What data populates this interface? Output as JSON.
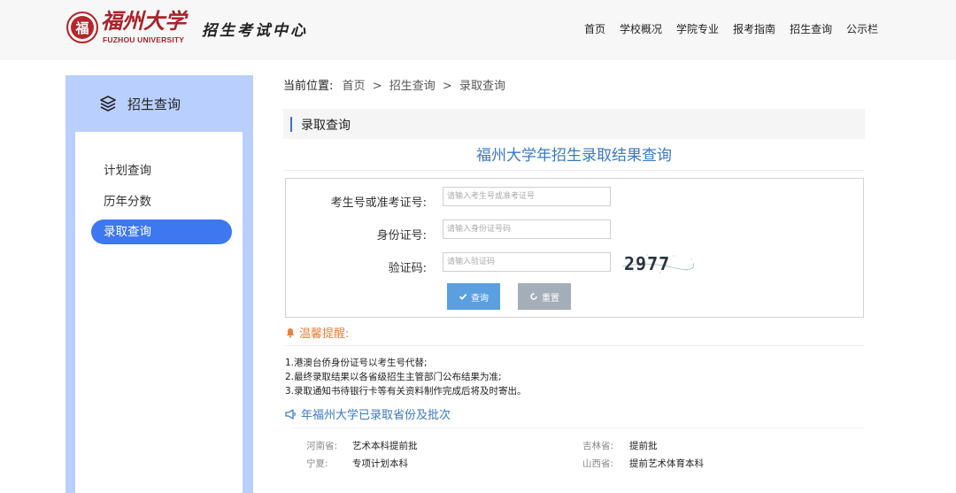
{
  "header": {
    "logo_seal_char": "福",
    "logo_cn": "福州大学",
    "logo_en": "FUZHOU UNIVERSITY",
    "site_name": "招生考试中心",
    "nav": [
      "首页",
      "学校概况",
      "学院专业",
      "报考指南",
      "招生查询",
      "公示栏"
    ]
  },
  "sidebar": {
    "title": "招生查询",
    "title_icon": "layers-icon",
    "items": [
      {
        "label": "计划查询",
        "active": false
      },
      {
        "label": "历年分数",
        "active": false
      },
      {
        "label": "录取查询",
        "active": true
      }
    ],
    "accent_color": "#b9d0ff",
    "active_color": "#3d78f0"
  },
  "breadcrumb": {
    "label": "当前位置:",
    "items": [
      "首页",
      "招生查询",
      "录取查询"
    ],
    "separator": ">"
  },
  "section": {
    "title": "录取查询",
    "heading": "福州大学年招生录取结果查询"
  },
  "form": {
    "fields": [
      {
        "label": "考生号或准考证号:",
        "placeholder": "请输入考生号或准考证号",
        "value": ""
      },
      {
        "label": "身份证号:",
        "placeholder": "请输入身份证号码",
        "value": ""
      },
      {
        "label": "验证码:",
        "placeholder": "请输入验证码",
        "value": ""
      }
    ],
    "captcha_text": "2977",
    "query_button": "查询",
    "reset_button": "重置",
    "query_icon": "check-icon",
    "reset_icon": "refresh-icon"
  },
  "tips": {
    "title": "温馨提醒:",
    "icon": "bell-icon",
    "lines": [
      "1.港澳台侨身份证号以考生号代替;",
      "2.最终录取结果以各省级招生主管部门公布结果为准;",
      "3.录取通知书待银行卡等有关资料制作完成后将及时寄出。"
    ]
  },
  "provinces": {
    "title": "年福州大学已录取省份及批次",
    "icon": "megaphone-icon",
    "rows": [
      [
        {
          "name": "河南省:",
          "batch": "艺术本科提前批"
        },
        {
          "name": "吉林省:",
          "batch": "提前批"
        }
      ],
      [
        {
          "name": "宁夏:",
          "batch": "专项计划本科"
        },
        {
          "name": "山西省:",
          "batch": "提前艺术体育本科"
        }
      ]
    ]
  }
}
